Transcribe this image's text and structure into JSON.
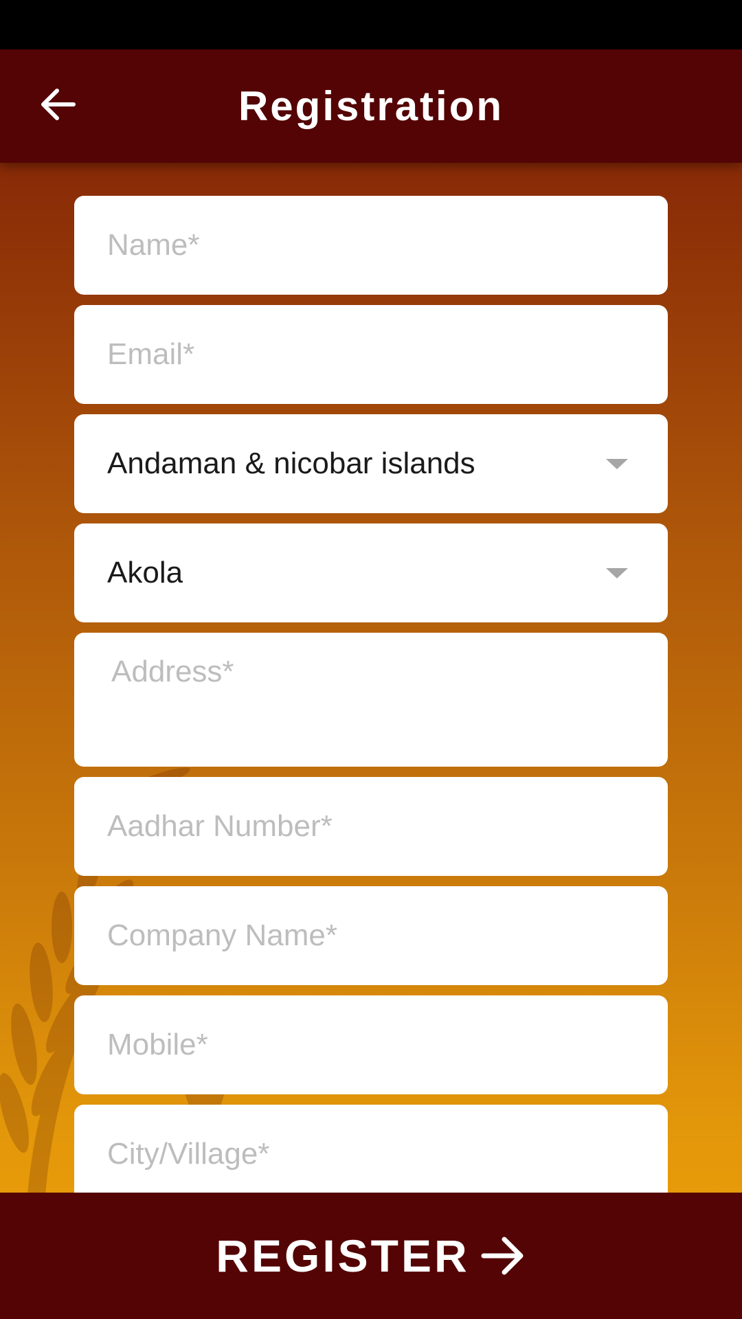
{
  "header": {
    "title": "Registration",
    "back_icon": "arrow-left-icon"
  },
  "form": {
    "name_placeholder": "Name*",
    "email_placeholder": "Email*",
    "state_selected": "Andaman & nicobar islands",
    "district_selected": "Akola",
    "address_placeholder": "Address*",
    "aadhar_placeholder": "Aadhar Number*",
    "company_placeholder": "Company Name*",
    "mobile_placeholder": "Mobile*",
    "city_placeholder": "City/Village*"
  },
  "footer": {
    "register_label": "REGISTER",
    "register_icon": "arrow-right-icon"
  },
  "colors": {
    "bar": "#540404",
    "gradient_top": "#7a1a06",
    "gradient_bottom": "#f0a30a",
    "placeholder": "#bdbdbd",
    "caret": "#a6a6a6"
  }
}
